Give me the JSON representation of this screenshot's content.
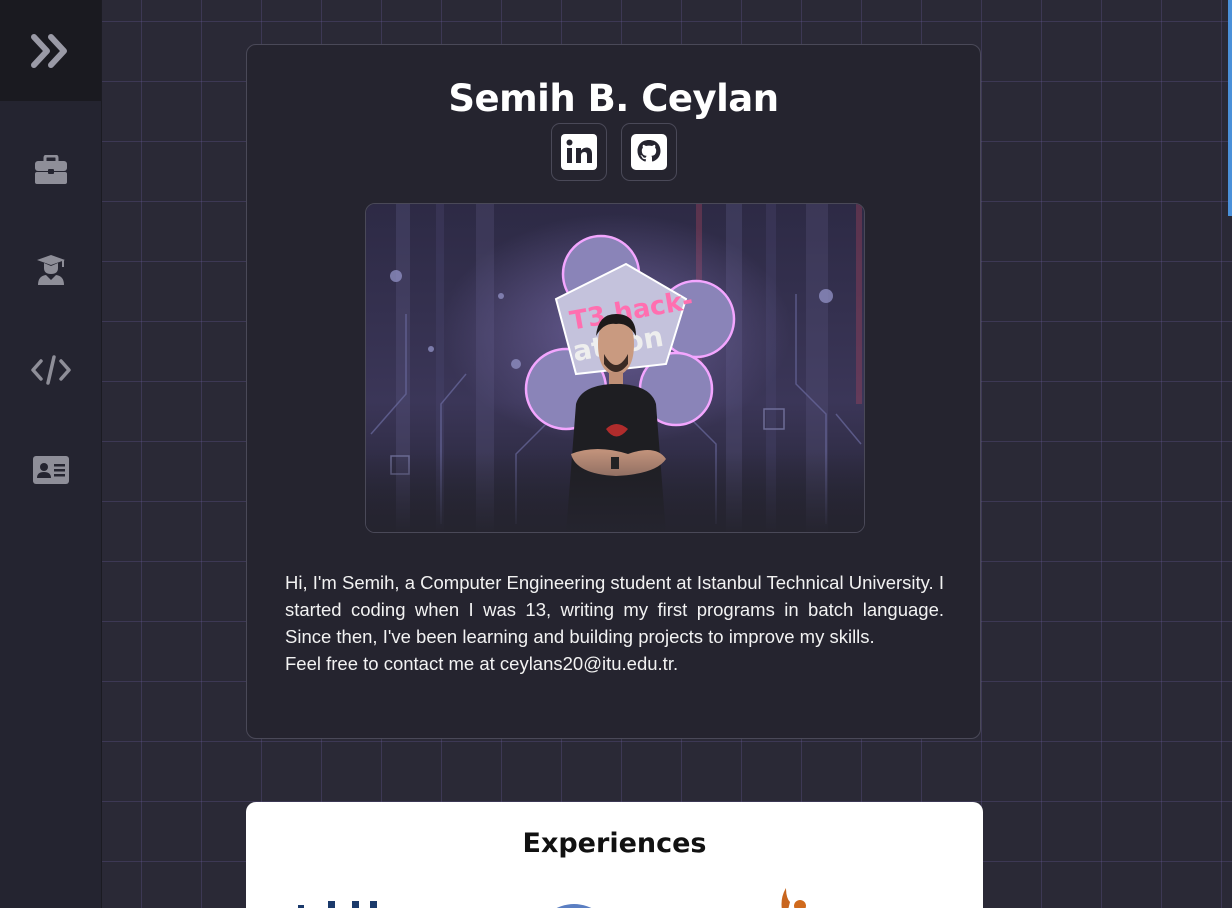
{
  "sidebar": {
    "toggle_icon": "chevrons-right-icon",
    "items": [
      {
        "id": "experiences",
        "icon": "briefcase-icon"
      },
      {
        "id": "education",
        "icon": "graduate-icon"
      },
      {
        "id": "projects",
        "icon": "code-icon"
      },
      {
        "id": "contact",
        "icon": "id-card-icon"
      }
    ]
  },
  "profile": {
    "name": "Semih B. Ceylan",
    "social": [
      {
        "id": "linkedin",
        "icon": "linkedin-icon"
      },
      {
        "id": "github",
        "icon": "github-icon"
      }
    ],
    "bio_line1": "Hi, I'm Semih, a Computer Engineering student at Istanbul Technical University. I started coding when I was 13, writing my first programs in batch language. Since then, I've been learning and building projects to improve my skills.",
    "bio_line2": "Feel free to contact me at ceylans20@itu.edu.tr."
  },
  "experiences": {
    "title": "Experiences"
  },
  "colors": {
    "background": "#2a2936",
    "sidebar": "#242430",
    "card": "#25242f",
    "accent_scroll": "#4a90d9"
  }
}
